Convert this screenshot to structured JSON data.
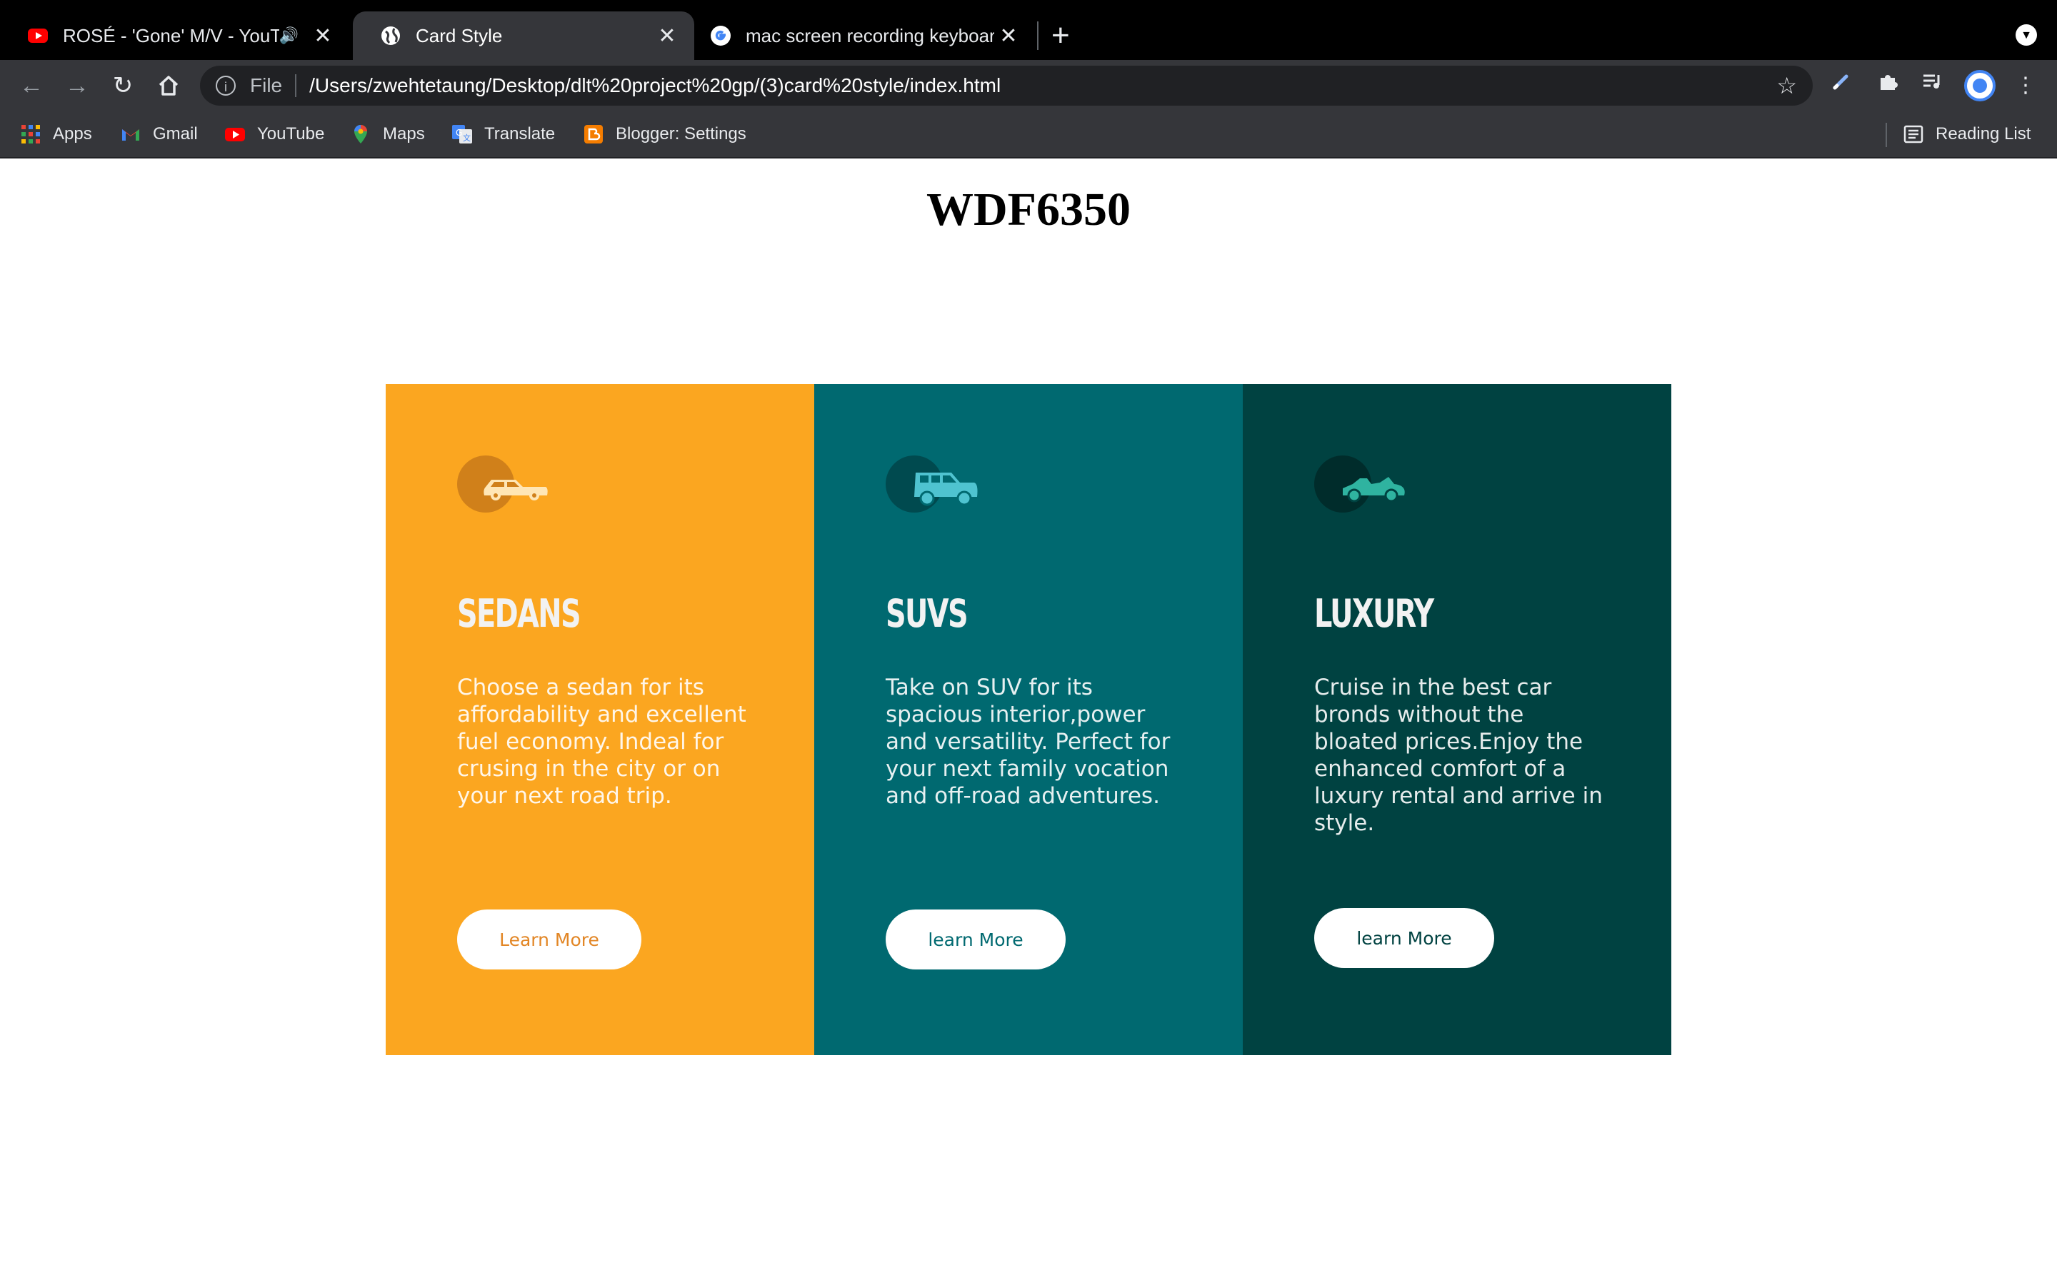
{
  "browser": {
    "tabs": [
      {
        "title": "ROSÉ - 'Gone' M/V - YouTu",
        "favicon": "youtube-icon",
        "audio": true
      },
      {
        "title": "Card Style",
        "favicon": "globe-icon",
        "active": true
      },
      {
        "title": "mac screen recording keyboarc",
        "favicon": "google-icon"
      }
    ],
    "new_tab": "+",
    "omnibox": {
      "scheme": "File",
      "url": "/Users/zwehtetaung/Desktop/dlt%20project%20gp/(3)card%20style/index.html"
    },
    "bookmarks": [
      {
        "label": "Apps",
        "icon": "apps-grid-icon"
      },
      {
        "label": "Gmail",
        "icon": "gmail-icon"
      },
      {
        "label": "YouTube",
        "icon": "youtube-icon"
      },
      {
        "label": "Maps",
        "icon": "maps-pin-icon"
      },
      {
        "label": "Translate",
        "icon": "translate-icon"
      },
      {
        "label": "Blogger: Settings",
        "icon": "blogger-icon"
      }
    ],
    "reading_list": "Reading List"
  },
  "page": {
    "title": "WDF6350",
    "cards": [
      {
        "id": "sedans",
        "heading": "SEDANS",
        "text": "Choose a sedan for its affordability and excellent fuel economy. Indeal for crusing in the city or on your next road trip.",
        "button": "Learn More",
        "color": "#fba620",
        "icon": "sedan-car-icon"
      },
      {
        "id": "suvs",
        "heading": "SUVS",
        "text": "Take on SUV for its spacious interior,power and versatility. Perfect for your next family vocation and off-road adventures.",
        "button": "learn More",
        "color": "#006970",
        "icon": "suv-car-icon"
      },
      {
        "id": "luxury",
        "heading": "LUXURY",
        "text": "Cruise in the best car bronds without the bloated prices.Enjoy the enhanced comfort of a luxury rental and arrive in style.",
        "button": "learn More",
        "color": "#004241",
        "icon": "luxury-car-icon"
      }
    ]
  }
}
